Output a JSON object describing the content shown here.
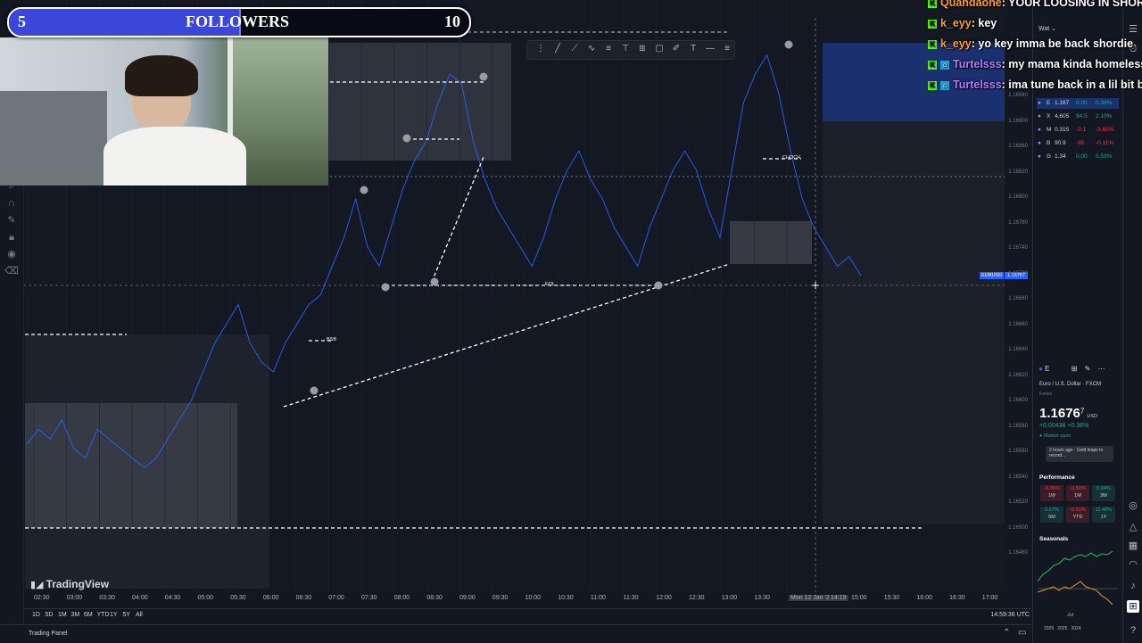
{
  "followers": {
    "current": "5",
    "label": "FOLLOWERS",
    "goal": "10",
    "progress": 0.5
  },
  "chat": [
    {
      "user": "Quandaone",
      "message": ": YOUR LOOSING IN SHORT",
      "user_color": "#ff9f1a",
      "badges": [
        "k"
      ]
    },
    {
      "user": "k_eyy",
      "message": ": key",
      "user_color": "#ff9f1a",
      "badges": [
        "k"
      ]
    },
    {
      "user": "k_eyy",
      "message": ": yo key imma be back shordie",
      "user_color": "#ff9f1a",
      "badges": [
        "k"
      ]
    },
    {
      "user": "Turtelsss",
      "message": ": my mama kinda homeless",
      "user_color": "#b57bff",
      "badges": [
        "k",
        "sub"
      ]
    },
    {
      "user": "Turtelsss",
      "message": ": ima tune back in a lil bit bro",
      "user_color": "#b57bff",
      "badges": [
        "k",
        "sub"
      ]
    }
  ],
  "chart": {
    "logo_text": "TradingView",
    "bos_label": "BSB",
    "choch_label": "CHOCH",
    "eql_label": "EQL",
    "symbol_tag": "EURUSD",
    "price_tag": "1.16767",
    "price_ticks": [
      "1.16940",
      "1.16900",
      "1.16860",
      "1.16820",
      "1.16800",
      "1.16780",
      "1.16740",
      "1.16700",
      "1.16680",
      "1.16660",
      "1.16640",
      "1.16620",
      "1.16600",
      "1.16580",
      "1.16560",
      "1.16540",
      "1.16520",
      "1.16500",
      "1.16480"
    ],
    "time_ticks": [
      "02:30",
      "03:00",
      "03:30",
      "04:00",
      "04:30",
      "05:00",
      "05:30",
      "06:00",
      "06:30",
      "07:00",
      "07:30",
      "08:00",
      "08:30",
      "09:00",
      "09:30",
      "10:00",
      "10:30",
      "11:00",
      "11:30",
      "12:00",
      "12:30",
      "13:00",
      "13:30",
      "Mon 12 Jan '26",
      "14:19",
      "15:00",
      "15:30",
      "16:00",
      "16:30",
      "17:00"
    ],
    "timeframes": [
      "1D",
      "5D",
      "1M",
      "3M",
      "6M",
      "YTD",
      "1Y",
      "5Y",
      "All"
    ],
    "clock": "14:59:36 UTC",
    "price_series": [
      1.16575,
      1.1659,
      1.1658,
      1.166,
      1.1657,
      1.1656,
      1.1659,
      1.1658,
      1.1657,
      1.1656,
      1.1655,
      1.1656,
      1.1658,
      1.166,
      1.1662,
      1.1665,
      1.1668,
      1.167,
      1.1672,
      1.1668,
      1.1666,
      1.1665,
      1.1668,
      1.167,
      1.1672,
      1.1673,
      1.1676,
      1.1679,
      1.1683,
      1.1678,
      1.1676,
      1.168,
      1.1684,
      1.1687,
      1.1689,
      1.1693,
      1.1696,
      1.1695,
      1.1689,
      1.1685,
      1.1682,
      1.168,
      1.1678,
      1.1676,
      1.1679,
      1.1683,
      1.1686,
      1.1688,
      1.1685,
      1.1683,
      1.168,
      1.1678,
      1.1676,
      1.168,
      1.1683,
      1.1686,
      1.1688,
      1.1686,
      1.1682,
      1.1679,
      1.1686,
      1.1693,
      1.1696,
      1.1698,
      1.1694,
      1.1688,
      1.1683,
      1.168,
      1.1678,
      1.1676,
      1.1677,
      1.1675
    ]
  },
  "draw_toolbar": [
    "crosshair",
    "trend-line",
    "path",
    "brush",
    "fib",
    "text",
    "lines",
    "rect",
    "pen",
    "T",
    "minus",
    "more"
  ],
  "left_toolbar": [
    "magnet",
    "lock",
    "hide",
    "eye",
    "trash"
  ],
  "watchlist": {
    "title": "Wat",
    "rows": [
      {
        "sym": "E",
        "last": "1.167",
        "chg": "0.00",
        "pct": "0.38%",
        "color": "#26a69a"
      },
      {
        "sym": "X",
        "last": "4,605",
        "chg": "94.5",
        "pct": "2.10%",
        "color": "#26a69a"
      },
      {
        "sym": "M",
        "last": "0.315",
        "chg": "-0.1",
        "pct": "-3.65%",
        "color": "#f23645"
      },
      {
        "sym": "B",
        "last": "90.9",
        "chg": "-95",
        "pct": "-0.11%",
        "color": "#f23645"
      },
      {
        "sym": "G",
        "last": "1.34",
        "chg": "0.00",
        "pct": "0.53%",
        "color": "#26a69a"
      }
    ]
  },
  "details": {
    "header": "E",
    "name": "Euro / U.S. Dollar",
    "source": "FXCM",
    "type": "Forex",
    "price_main": "1.1676",
    "price_sup": "7",
    "currency": "USD",
    "change": "+0.00438",
    "change_pct": "+0.38%",
    "market": "Market open",
    "news": "2 hours ago · Gold leaps to record...",
    "performance_label": "Performance",
    "performance": [
      {
        "label": "1W",
        "value": "-0.36%",
        "color": "#f23645"
      },
      {
        "label": "1M",
        "value": "-0.50%",
        "color": "#f23645"
      },
      {
        "label": "3M",
        "value": "0.94%",
        "color": "#26a69a"
      },
      {
        "label": "6M",
        "value": "0.67%",
        "color": "#26a69a"
      },
      {
        "label": "YTD",
        "value": "-0.51%",
        "color": "#f23645"
      },
      {
        "label": "1Y",
        "value": "11.40%",
        "color": "#26a69a"
      }
    ],
    "seasonals_label": "Seasonals",
    "seasonals_years": [
      "2026",
      "2025",
      "2024"
    ],
    "seasonals_month": "Jul"
  },
  "status_bar": {
    "panel_label": "Trading Panel"
  },
  "colors": {
    "accent": "#2962ff",
    "candle": "#2962ff",
    "up": "#26a69a",
    "down": "#f23645",
    "bg": "#131722"
  }
}
